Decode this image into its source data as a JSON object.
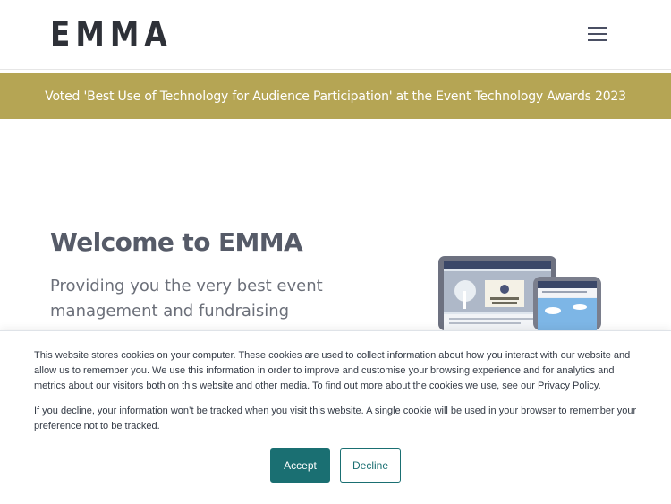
{
  "header": {
    "logo_text": "EMMA",
    "menu_icon": "hamburger-menu-icon"
  },
  "banner": {
    "text": "Voted 'Best Use of Technology for Audience Participation' at the Event Technology Awards 2023"
  },
  "hero": {
    "title": "Welcome to EMMA",
    "subtitle": "Providing you the very best event management and fundraising"
  },
  "cookie_notice": {
    "paragraph1": "This website stores cookies on your computer. These cookies are used to collect information about how you interact with our website and allow us to remember you. We use this information in order to improve and customise your browsing experience and for analytics and metrics about our visitors both on this website and other media. To find out more about the cookies we use, see our Privacy Policy.",
    "paragraph2": "If you decline, your information won’t be tracked when you visit this website. A single cookie will be used in your browser to remember your preference not to be tracked.",
    "accept_label": "Accept",
    "decline_label": "Decline"
  },
  "colors": {
    "banner_bg": "#b5a554",
    "accent": "#1a6f72",
    "logo": "#2e3138"
  }
}
